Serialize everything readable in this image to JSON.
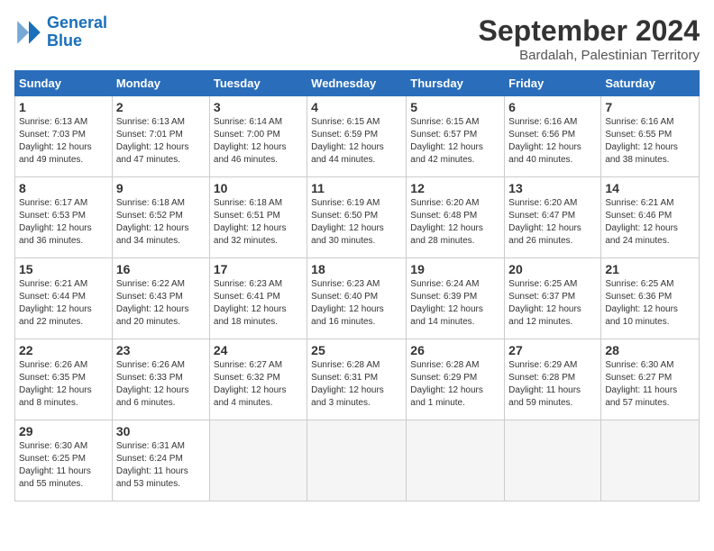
{
  "header": {
    "logo_line1": "General",
    "logo_line2": "Blue",
    "month": "September 2024",
    "location": "Bardalah, Palestinian Territory"
  },
  "days_of_week": [
    "Sunday",
    "Monday",
    "Tuesday",
    "Wednesday",
    "Thursday",
    "Friday",
    "Saturday"
  ],
  "weeks": [
    [
      {
        "num": "1",
        "rise": "6:13 AM",
        "set": "7:03 PM",
        "hours": "12 hours",
        "mins": "49 minutes"
      },
      {
        "num": "2",
        "rise": "6:13 AM",
        "set": "7:01 PM",
        "hours": "12 hours",
        "mins": "47 minutes"
      },
      {
        "num": "3",
        "rise": "6:14 AM",
        "set": "7:00 PM",
        "hours": "12 hours",
        "mins": "46 minutes"
      },
      {
        "num": "4",
        "rise": "6:15 AM",
        "set": "6:59 PM",
        "hours": "12 hours",
        "mins": "44 minutes"
      },
      {
        "num": "5",
        "rise": "6:15 AM",
        "set": "6:57 PM",
        "hours": "12 hours",
        "mins": "42 minutes"
      },
      {
        "num": "6",
        "rise": "6:16 AM",
        "set": "6:56 PM",
        "hours": "12 hours",
        "mins": "40 minutes"
      },
      {
        "num": "7",
        "rise": "6:16 AM",
        "set": "6:55 PM",
        "hours": "12 hours",
        "mins": "38 minutes"
      }
    ],
    [
      {
        "num": "8",
        "rise": "6:17 AM",
        "set": "6:53 PM",
        "hours": "12 hours",
        "mins": "36 minutes"
      },
      {
        "num": "9",
        "rise": "6:18 AM",
        "set": "6:52 PM",
        "hours": "12 hours",
        "mins": "34 minutes"
      },
      {
        "num": "10",
        "rise": "6:18 AM",
        "set": "6:51 PM",
        "hours": "12 hours",
        "mins": "32 minutes"
      },
      {
        "num": "11",
        "rise": "6:19 AM",
        "set": "6:50 PM",
        "hours": "12 hours",
        "mins": "30 minutes"
      },
      {
        "num": "12",
        "rise": "6:20 AM",
        "set": "6:48 PM",
        "hours": "12 hours",
        "mins": "28 minutes"
      },
      {
        "num": "13",
        "rise": "6:20 AM",
        "set": "6:47 PM",
        "hours": "12 hours",
        "mins": "26 minutes"
      },
      {
        "num": "14",
        "rise": "6:21 AM",
        "set": "6:46 PM",
        "hours": "12 hours",
        "mins": "24 minutes"
      }
    ],
    [
      {
        "num": "15",
        "rise": "6:21 AM",
        "set": "6:44 PM",
        "hours": "12 hours",
        "mins": "22 minutes"
      },
      {
        "num": "16",
        "rise": "6:22 AM",
        "set": "6:43 PM",
        "hours": "12 hours",
        "mins": "20 minutes"
      },
      {
        "num": "17",
        "rise": "6:23 AM",
        "set": "6:41 PM",
        "hours": "12 hours",
        "mins": "18 minutes"
      },
      {
        "num": "18",
        "rise": "6:23 AM",
        "set": "6:40 PM",
        "hours": "12 hours",
        "mins": "16 minutes"
      },
      {
        "num": "19",
        "rise": "6:24 AM",
        "set": "6:39 PM",
        "hours": "12 hours",
        "mins": "14 minutes"
      },
      {
        "num": "20",
        "rise": "6:25 AM",
        "set": "6:37 PM",
        "hours": "12 hours",
        "mins": "12 minutes"
      },
      {
        "num": "21",
        "rise": "6:25 AM",
        "set": "6:36 PM",
        "hours": "12 hours",
        "mins": "10 minutes"
      }
    ],
    [
      {
        "num": "22",
        "rise": "6:26 AM",
        "set": "6:35 PM",
        "hours": "12 hours",
        "mins": "8 minutes"
      },
      {
        "num": "23",
        "rise": "6:26 AM",
        "set": "6:33 PM",
        "hours": "12 hours",
        "mins": "6 minutes"
      },
      {
        "num": "24",
        "rise": "6:27 AM",
        "set": "6:32 PM",
        "hours": "12 hours",
        "mins": "4 minutes"
      },
      {
        "num": "25",
        "rise": "6:28 AM",
        "set": "6:31 PM",
        "hours": "12 hours",
        "mins": "3 minutes"
      },
      {
        "num": "26",
        "rise": "6:28 AM",
        "set": "6:29 PM",
        "hours": "12 hours",
        "mins": "1 minute"
      },
      {
        "num": "27",
        "rise": "6:29 AM",
        "set": "6:28 PM",
        "hours": "11 hours",
        "mins": "59 minutes"
      },
      {
        "num": "28",
        "rise": "6:30 AM",
        "set": "6:27 PM",
        "hours": "11 hours",
        "mins": "57 minutes"
      }
    ],
    [
      {
        "num": "29",
        "rise": "6:30 AM",
        "set": "6:25 PM",
        "hours": "11 hours",
        "mins": "55 minutes"
      },
      {
        "num": "30",
        "rise": "6:31 AM",
        "set": "6:24 PM",
        "hours": "11 hours",
        "mins": "53 minutes"
      },
      null,
      null,
      null,
      null,
      null
    ]
  ]
}
